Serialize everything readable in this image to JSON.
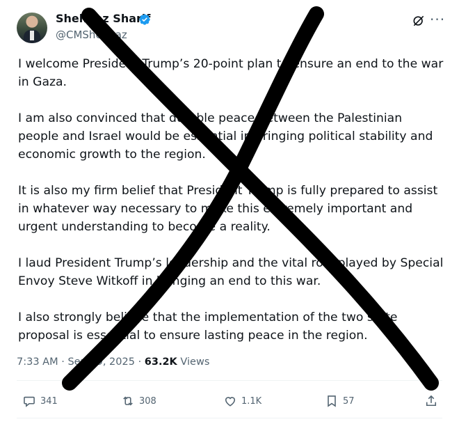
{
  "author": {
    "display_name": "Shehbaz Sharif",
    "handle": "@CMShehbaz"
  },
  "tweet": {
    "paragraphs": [
      "I welcome President Trump’s 20-point plan to ensure an end to the war in Gaza.",
      "I am also convinced that durable peace between the Palestinian people and Israel would be essential in bringing political stability and economic growth to the region.",
      "It is also my firm belief that President Trump is fully prepared to assist in whatever way necessary to make this extremely important and urgent understanding to become a reality.",
      "I laud President Trump’s leadership and the vital role played by Special Envoy Steve Witkoff in bringing an end to this war.",
      "I also strongly believe that the implementation of the two state proposal is essential to ensure lasting peace in the region."
    ],
    "time": "7:33 AM",
    "separator": "·",
    "date": "Sep 29, 2025",
    "views_count": "63.2K",
    "views_label": "Views"
  },
  "actions": {
    "replies": "341",
    "reposts": "308",
    "likes": "1.1K",
    "bookmarks": "57"
  },
  "colors": {
    "verified": "#1d9bf0",
    "muted": "#536471",
    "text": "#0f1419",
    "scribble": "#000000"
  }
}
